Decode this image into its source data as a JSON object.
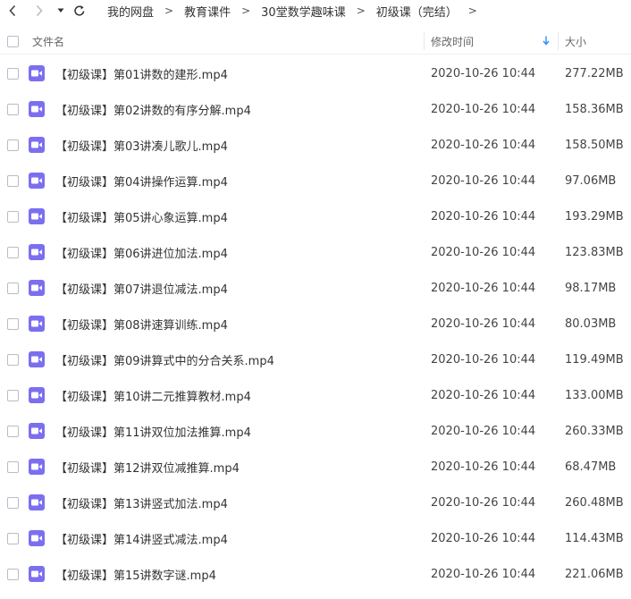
{
  "breadcrumb": [
    "我的网盘",
    "教育课件",
    "30堂数学趣味课",
    "初级课（完结）"
  ],
  "breadcrumb_separator": ">",
  "columns": {
    "name": "文件名",
    "modified": "修改时间",
    "size": "大小"
  },
  "sort_indicator": "arrow-down-icon",
  "file_icon": "video-file-icon",
  "accent_color": "#2f8ef5",
  "icon_color": "#7b6ff0",
  "files": [
    {
      "name": "【初级课】第01讲数的建形.mp4",
      "modified": "2020-10-26 10:44",
      "size": "277.22MB"
    },
    {
      "name": "【初级课】第02讲数的有序分解.mp4",
      "modified": "2020-10-26 10:44",
      "size": "158.36MB"
    },
    {
      "name": "【初级课】第03讲凑儿歌儿.mp4",
      "modified": "2020-10-26 10:44",
      "size": "158.50MB"
    },
    {
      "name": "【初级课】第04讲操作运算.mp4",
      "modified": "2020-10-26 10:44",
      "size": "97.06MB"
    },
    {
      "name": "【初级课】第05讲心象运算.mp4",
      "modified": "2020-10-26 10:44",
      "size": "193.29MB"
    },
    {
      "name": "【初级课】第06讲进位加法.mp4",
      "modified": "2020-10-26 10:44",
      "size": "123.83MB"
    },
    {
      "name": "【初级课】第07讲退位减法.mp4",
      "modified": "2020-10-26 10:44",
      "size": "98.17MB"
    },
    {
      "name": "【初级课】第08讲速算训练.mp4",
      "modified": "2020-10-26 10:44",
      "size": "80.03MB"
    },
    {
      "name": "【初级课】第09讲算式中的分合关系.mp4",
      "modified": "2020-10-26 10:44",
      "size": "119.49MB"
    },
    {
      "name": "【初级课】第10讲二元推算教材.mp4",
      "modified": "2020-10-26 10:44",
      "size": "133.00MB"
    },
    {
      "name": "【初级课】第11讲双位加法推算.mp4",
      "modified": "2020-10-26 10:44",
      "size": "260.33MB"
    },
    {
      "name": "【初级课】第12讲双位减推算.mp4",
      "modified": "2020-10-26 10:44",
      "size": "68.47MB"
    },
    {
      "name": "【初级课】第13讲竖式加法.mp4",
      "modified": "2020-10-26 10:44",
      "size": "260.48MB"
    },
    {
      "name": "【初级课】第14讲竖式减法.mp4",
      "modified": "2020-10-26 10:44",
      "size": "114.43MB"
    },
    {
      "name": "【初级课】第15讲数字谜.mp4",
      "modified": "2020-10-26 10:44",
      "size": "221.06MB"
    }
  ]
}
